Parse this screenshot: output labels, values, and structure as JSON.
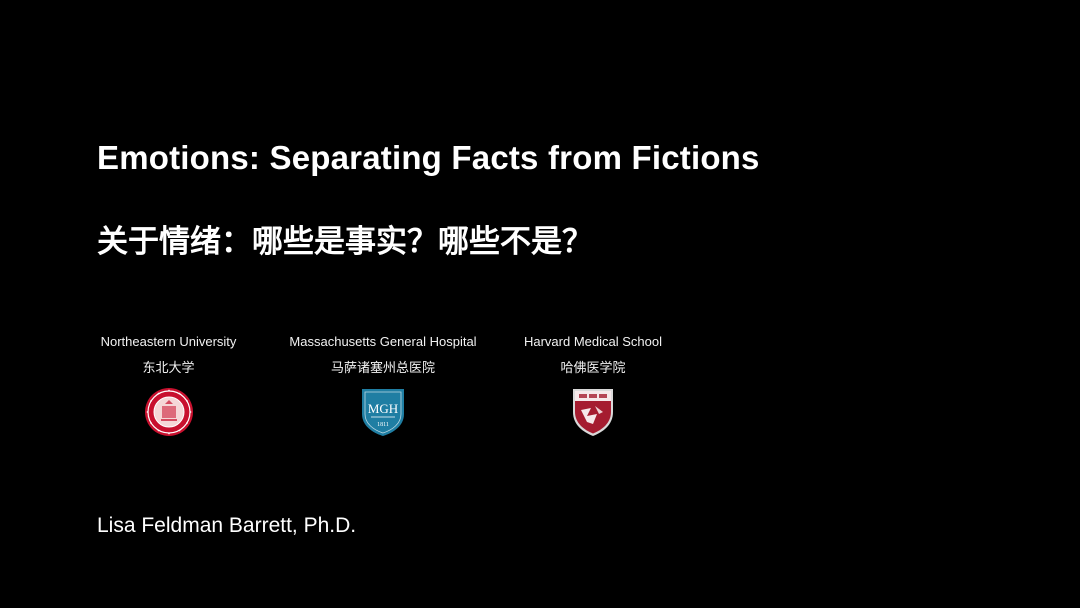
{
  "slide": {
    "title_en": "Emotions: Separating Facts from Fictions",
    "title_zh": "关于情绪：哪些是事实？哪些不是？",
    "author": "Lisa Feldman Barrett, Ph.D."
  },
  "institutions": [
    {
      "name_en": "Northeastern University",
      "name_zh": "东北大学",
      "logo_icon": "northeastern-seal-icon",
      "color": "#c8102e"
    },
    {
      "name_en": "Massachusetts General Hospital",
      "name_zh": "马萨诸塞州总医院",
      "logo_icon": "mgh-shield-icon",
      "logo_text": "MGH",
      "logo_year": "1811",
      "color": "#1f7ea3"
    },
    {
      "name_en": "Harvard Medical School",
      "name_zh": "哈佛医学院",
      "logo_icon": "harvard-medical-shield-icon",
      "color": "#a51c30"
    }
  ]
}
